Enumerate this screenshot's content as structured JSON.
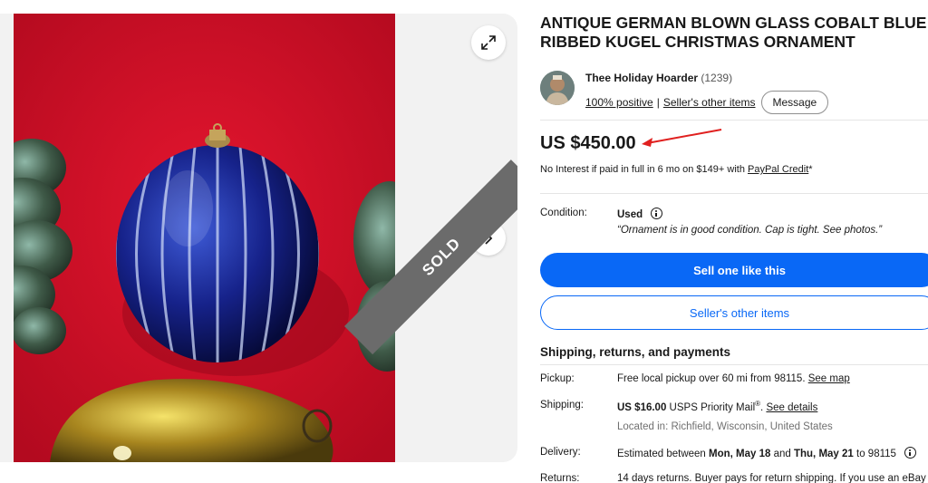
{
  "gallery": {
    "sold_label": "SOLD",
    "expand_icon": "expand-icon",
    "next_icon": "chevron-right-icon"
  },
  "item": {
    "title": "ANTIQUE GERMAN BLOWN GLASS COBALT BLUE RIBBED KUGEL CHRISTMAS ORNAMENT"
  },
  "seller": {
    "name": "Thee Holiday Hoarder",
    "count": "(1239)",
    "positive": "100% positive",
    "separator": "|",
    "other_items": "Seller's other items",
    "message_label": "Message"
  },
  "price": {
    "amount": "US $450.00",
    "credit_text": "No Interest if paid in full in 6 mo on $149+ with ",
    "credit_link": "PayPal Credit",
    "credit_suffix": "*"
  },
  "condition": {
    "label": "Condition:",
    "value": "Used",
    "note": "“Ornament is in good condition. Cap is tight. See photos.”"
  },
  "actions": {
    "primary": "Sell one like this",
    "secondary": "Seller's other items"
  },
  "shipping_section": {
    "title": "Shipping, returns, and payments",
    "pickup_label": "Pickup:",
    "pickup_value": "Free local pickup over 60 mi from 98115. ",
    "pickup_link": "See map",
    "shipping_label": "Shipping:",
    "shipping_price": "US $16.00",
    "shipping_service": " USPS Priority Mail",
    "shipping_mark": "®",
    "shipping_sep": ". ",
    "shipping_link": "See details",
    "located": "Located in: Richfield, Wisconsin, United States",
    "delivery_label": "Delivery:",
    "delivery_prefix": "Estimated between ",
    "delivery_start": "Mon, May 18",
    "delivery_and": " and ",
    "delivery_end": "Thu, May 21",
    "delivery_suffix": " to 98115",
    "returns_label": "Returns:",
    "returns_value": "14 days returns. Buyer pays for return shipping. If you use an eBay"
  },
  "colors": {
    "accent": "#0968f6",
    "background_photo": "#d4102a",
    "ribbon": "#6b6b6b",
    "annotation_arrow": "#e0201f"
  }
}
